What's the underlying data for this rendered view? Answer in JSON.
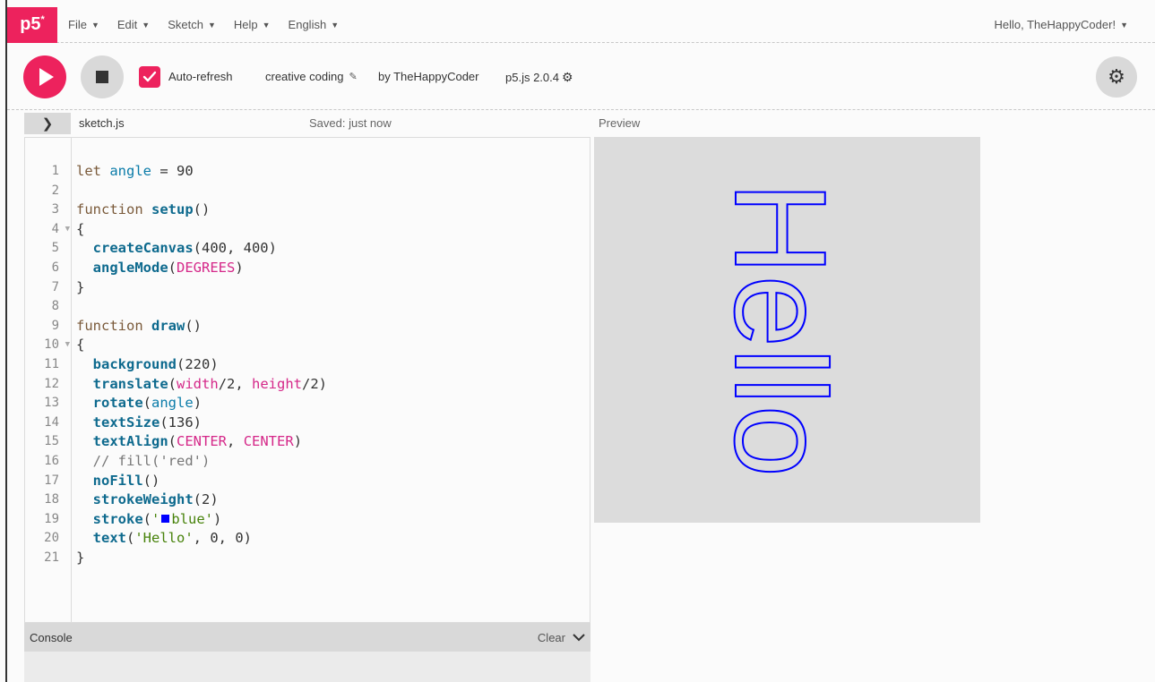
{
  "nav": {
    "logo": "p5",
    "logo_mark": "*",
    "menu": [
      {
        "label": "File"
      },
      {
        "label": "Edit"
      },
      {
        "label": "Sketch"
      },
      {
        "label": "Help"
      },
      {
        "label": "English"
      }
    ],
    "user": "Hello, TheHappyCoder!"
  },
  "toolbar": {
    "auto_refresh_label": "Auto-refresh",
    "auto_refresh_checked": true,
    "sketch_name": "creative coding",
    "byline": "by TheHappyCoder",
    "version": "p5.js 2.0.4"
  },
  "editor": {
    "file_name": "sketch.js",
    "saved_status": "Saved: just now",
    "preview_label": "Preview",
    "line_numbers": [
      "1",
      "2",
      "3",
      "4",
      "5",
      "6",
      "7",
      "8",
      "9",
      "10",
      "11",
      "12",
      "13",
      "14",
      "15",
      "16",
      "17",
      "18",
      "19",
      "20",
      "21"
    ]
  },
  "console": {
    "label": "Console",
    "clear_label": "Clear"
  },
  "preview": {
    "text": "Hello",
    "background": "#dcdcdc",
    "stroke_color": "#0000ff"
  },
  "colors": {
    "accent": "#ed225d"
  }
}
